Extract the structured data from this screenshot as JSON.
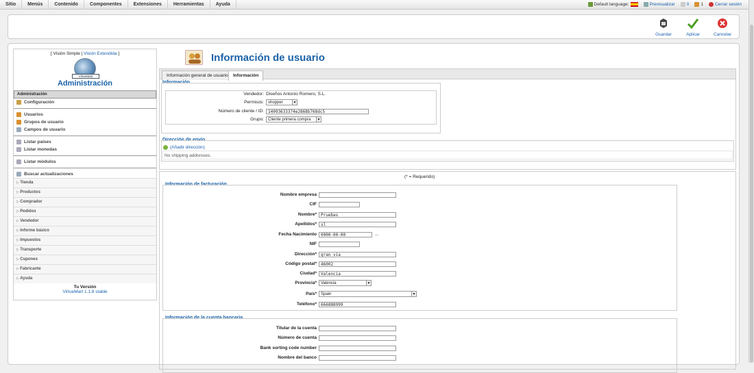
{
  "menubar": {
    "items": [
      "Sitio",
      "Menús",
      "Contenido",
      "Componentes",
      "Extensiones",
      "Herramientas",
      "Ayuda"
    ],
    "default_language": "Default language:",
    "preview": "Previsualizar",
    "msg_count": "0",
    "users_count": "1",
    "logout": "Cerrar sesión"
  },
  "toolbar": {
    "save": "Guardar",
    "apply": "Aplicar",
    "cancel": "Cancelar"
  },
  "sidebar": {
    "view_prefix": "[ ",
    "view_simple": "Visión Simple",
    "view_sep": " | ",
    "view_extended": "Visión Extendida",
    "view_suffix": " ]",
    "logo_text": "VirtueMart",
    "title": "Administración",
    "header": "Administración",
    "group1": [
      "Configuración"
    ],
    "group2": [
      "Usuarios",
      "Grupos de usuario",
      "Campos de usuario"
    ],
    "group3": [
      "Listar países",
      "Listar monedas"
    ],
    "group4": [
      "Listar módulos"
    ],
    "group5": [
      "Buscar actualizaciones"
    ],
    "subs": [
      "Tienda",
      "Productos",
      "Comprador",
      "Pedidos",
      "Vendedor",
      "Informe básico",
      "Impuestos",
      "Transporte",
      "Cupones",
      "Fabricante",
      "Ayuda"
    ],
    "version_label": "Tu Versión",
    "version_value": "VirtueMart 1.1.8 stable"
  },
  "page": {
    "title": "Información de usuario",
    "tabs": [
      "Información general de usuario",
      "Información"
    ]
  },
  "info": {
    "section": "Información",
    "vendor_label": "Vendedor:",
    "vendor_value": "Diseños Antonio Romero, S.L.",
    "perm_label": "Permisos:",
    "perm_value": "shopper",
    "id_label": "Número de cliente / ID:",
    "id_value": "14093633374e2868b768dc5",
    "group_label": "Grupo:",
    "group_value": "Cliente primera compra"
  },
  "shipping": {
    "section": "Dirección de envío",
    "add": "(Añadir dirección)",
    "none": "No shipping addresses."
  },
  "required_note": "(* = Requerido)",
  "billing": {
    "section": "Información de facturación",
    "fields": [
      {
        "label": "Nombre empresa",
        "value": "",
        "type": "input"
      },
      {
        "label": "CIF",
        "value": "",
        "type": "short"
      },
      {
        "label": "Nombre*",
        "value": "Pruebas",
        "type": "input"
      },
      {
        "label": "Apellidos*",
        "value": "sl",
        "type": "input"
      },
      {
        "label": "Fecha Nacimiento",
        "value": "0000-00-00",
        "type": "date"
      },
      {
        "label": "NIF",
        "value": "",
        "type": "short"
      },
      {
        "label": "Dirección*",
        "value": "gran via",
        "type": "input"
      },
      {
        "label": "Código postal*",
        "value": "46002",
        "type": "input"
      },
      {
        "label": "Ciudad*",
        "value": "Valencia",
        "type": "input"
      },
      {
        "label": "Provincia*",
        "value": "Valencia",
        "type": "select"
      },
      {
        "label": "País*",
        "value": "Spain",
        "type": "wideselect"
      },
      {
        "label": "Teléfono*",
        "value": "666888999",
        "type": "input"
      }
    ],
    "date_button": "..."
  },
  "bank": {
    "section": "Información de la cuenta bancaria",
    "fields": [
      "Titular de la cuenta",
      "Número de cuenta",
      "Bank sorting code number",
      "Nombre del banco"
    ]
  }
}
